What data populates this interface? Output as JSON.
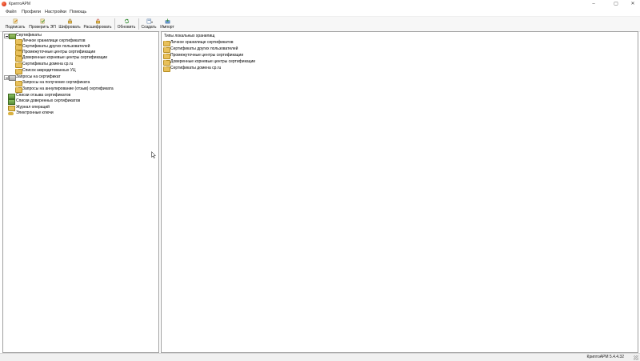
{
  "window": {
    "title": "КриптоАРМ",
    "minimize": "–",
    "maximize": "▢",
    "close": "✕"
  },
  "menu": [
    "Файл",
    "Профили",
    "Настройки",
    "Помощь"
  ],
  "toolbar": {
    "sign": "Подписать",
    "verify": "Проверить ЭП",
    "encrypt": "Шифровать",
    "decrypt": "Расшифровать",
    "refresh": "Обновить",
    "create": "Создать",
    "import": "Импорт",
    "create_arrow": "▾"
  },
  "tree": {
    "certificates": {
      "label": "Сертификаты",
      "children": [
        "Личное хранилище сертификатов",
        "Сертификаты других пользователей",
        "Промежуточные центры сертификации",
        "Доверенные корневые центры сертификации",
        "Сертификаты домена cp.ru",
        "Список аккредитованных УЦ"
      ]
    },
    "requests": {
      "label": "Запросы на сертификат",
      "children": [
        "Запросы на получение сертификата",
        "Запросы на аннулирование (отзыв) сертификата"
      ]
    },
    "revocation_lists": "Списки отзыва сертификатов",
    "trusted_lists": "Списки доверенных сертификатов",
    "journal": "Журнал операций",
    "keys": "Электронные ключи"
  },
  "right_pane": {
    "header": "Типы локальных хранилищ",
    "items": [
      "Личное хранилище сертификатов",
      "Сертификаты других пользователей",
      "Промежуточные центры сертификации",
      "Доверенные корневые центры сертификации",
      "Сертификаты домена cp.ru"
    ]
  },
  "status": {
    "version": "КриптоАРМ 5.4.4.32"
  },
  "colors": {
    "folder": "#e8c05a",
    "cert_green": "#6f9a3a",
    "border": "#a0a0a0"
  }
}
